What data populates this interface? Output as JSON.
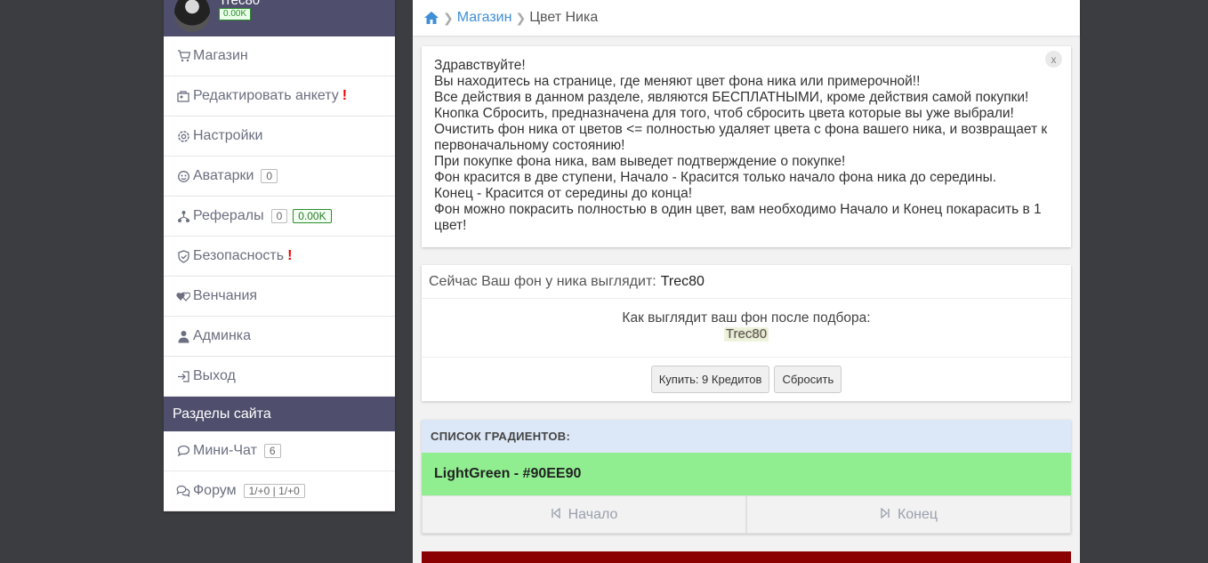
{
  "user": {
    "name": "Trec80",
    "credits": "0.00K"
  },
  "sidebar": {
    "items": [
      {
        "label": "Магазин",
        "icon": "cart-icon"
      },
      {
        "label": "Редактировать анкету",
        "icon": "edit-profile-icon",
        "alert": "!"
      },
      {
        "label": "Настройки",
        "icon": "gear-icon"
      },
      {
        "label": "Аватарки",
        "icon": "avatar-icon",
        "badge": "0"
      },
      {
        "label": "Рефералы",
        "icon": "referral-icon",
        "badge": "0",
        "money": "0.00K"
      },
      {
        "label": "Безопасность",
        "icon": "shield-icon",
        "alert": "!"
      },
      {
        "label": "Венчания",
        "icon": "hearts-icon"
      },
      {
        "label": "Админка",
        "icon": "admin-user-icon"
      },
      {
        "label": "Выход",
        "icon": "logout-icon"
      }
    ],
    "section_title": "Разделы сайта",
    "section_items": [
      {
        "label": "Мини-Чат",
        "icon": "chat-icon",
        "badge": "6"
      },
      {
        "label": "Форум",
        "icon": "forum-icon",
        "badge": "1/+0 | 1/+0"
      }
    ]
  },
  "breadcrumb": {
    "link": "Магазин",
    "current": "Цвет Ника"
  },
  "info": {
    "close": "x",
    "lines": [
      "Здравствуйте!",
      "Вы находитесь на странице, где меняют цвет фона ника или примерочной!!",
      "Все действия в данном разделе, являются БЕСПЛАТНЫМИ, кроме действия самой покупки!",
      "Кнопка Сбросить, предназначена для того, чтоб сбросить цвета которые вы уже выбрали!",
      "Очистить фон ника от цветов <= полностью удаляет цвета с фона вашего ника, и возвращает к первоначальному состоянию!",
      "При покупке фона ника, вам выведет подтверждение о покупке!",
      "Фон красится в две ступени, Начало - Красится только начало фона ника до середины.",
      "Конец - Красится от середины до конца!",
      "Фон можно покрасить полностью в один цвет, вам необходимо Начало и Конец покарасить в 1 цвет!"
    ]
  },
  "preview": {
    "current_label": "Сейчас Ваш фон у ника выглядит:",
    "current_nick": "Trec80",
    "after_label": "Как выглядит ваш фон после подбора:",
    "after_nick": "Trec80",
    "buy_button": "Купить: 9 Кредитов",
    "reset_button": "Сбросить"
  },
  "gradients": {
    "header": "СПИСОК ГРАДИЕНТОВ:",
    "items": [
      {
        "name": "LightGreen - #90EE90",
        "color": "#90EE90",
        "start_label": "Начало",
        "end_label": "Конец"
      }
    ],
    "next_color": "#8B0000"
  },
  "colors": {
    "sidebar_header": "#4F4F6D",
    "link": "#3F8FD6",
    "alert": "#EE0000"
  }
}
